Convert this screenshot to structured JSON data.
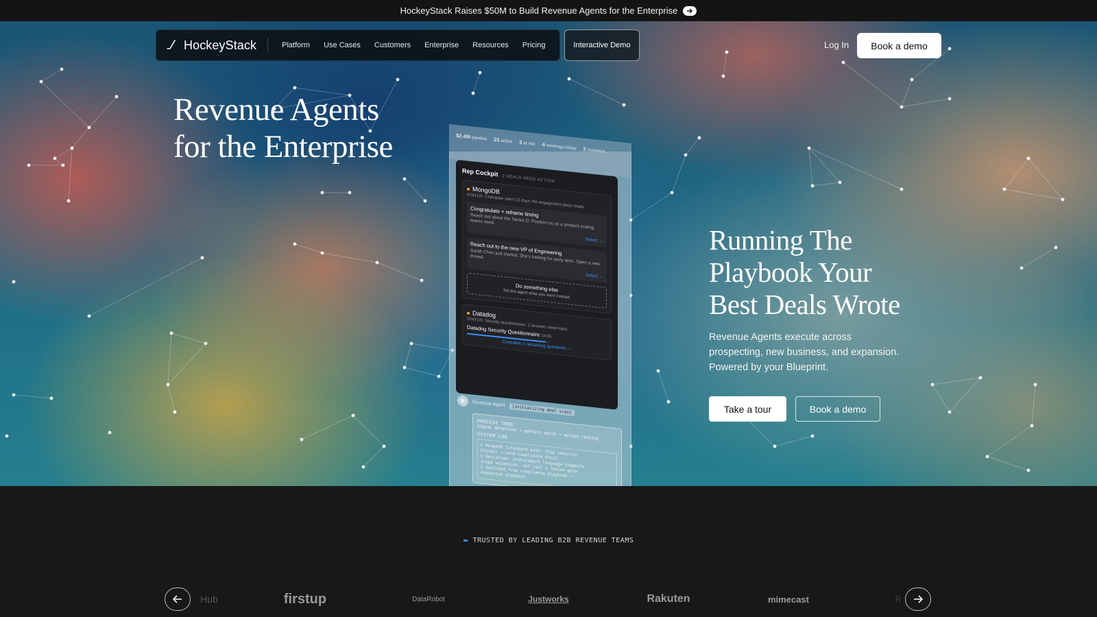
{
  "announcement": {
    "text": "HockeyStack Raises $50M to Build Revenue Agents for the Enterprise",
    "icon": "arrow-right-icon"
  },
  "nav": {
    "brand": "HockeyStack",
    "links": [
      "Platform",
      "Use Cases",
      "Customers",
      "Enterprise",
      "Resources",
      "Pricing"
    ],
    "interactive_demo": "Interactive Demo",
    "login": "Log In",
    "book_demo": "Book a demo"
  },
  "hero": {
    "headline": "Revenue Agents for the Enterprise",
    "subheadline": "Running The Playbook Your Best Deals Wrote",
    "description": "Revenue Agents execute across prospecting, new business, and expansion. Powered by your Blueprint.",
    "tour_button": "Take a tour",
    "book_button": "Book a demo"
  },
  "mockup": {
    "stats": [
      {
        "value": "$2.4M",
        "label": "pipeline"
      },
      {
        "value": "23",
        "label": "active"
      },
      {
        "value": "3",
        "label": "at risk"
      },
      {
        "value": "4",
        "label": "meetings today"
      },
      {
        "value": "2",
        "label": "convince"
      }
    ],
    "title": "Rep Cockpit",
    "subtitle": "2 DEALS NEED ACTION",
    "deal1": {
      "name": "MongoDB",
      "status": "STATUS: Champion silent 12 days. Re-engagement plays ready.",
      "action1_title": "Congratulate + reframe timing",
      "action1_desc": "Reach out about the Series D. Position us as a product scaling teams need.",
      "action2_title": "Reach out to the new VP of Engineering",
      "action2_desc": "Sarah Chen just started. She's looking for early wins. Open a new thread.",
      "select": "Select →",
      "else_title": "Do something else",
      "else_desc": "Tell the agent what you want instead."
    },
    "deal2": {
      "name": "Datadog",
      "status": "STATUS: Security questionnaire: 2 answers need input.",
      "task": "Datadog Security Questionnaire",
      "count": "34/36",
      "progress": 0.94,
      "link": "Complete 2 remaining questions →"
    },
    "agent": {
      "label": "Revenue Agent",
      "badge": "[initializing deal scan]",
      "process_title": "PROCESS TREE",
      "process_desc": "Signal detection → pattern match → action ranking",
      "log_title": "SYSTEM LOG",
      "log_lines": [
        "↳ MongoDB [standard path: flag security",
        "blocker → send compliance docs]",
        "↳ Deviation: procurement language suggests",
        "scope expansion, not just a review gate",
        "↳ Switched from compliance playbook →",
        "expansion playbook"
      ]
    }
  },
  "trusted": {
    "label": "TRUSTED BY LEADING B2B REVENUE TEAMS",
    "logos": [
      "Hub",
      "firstup",
      "DataRobot",
      "Justworks",
      "Rakuten",
      "mimecast",
      "R"
    ]
  }
}
